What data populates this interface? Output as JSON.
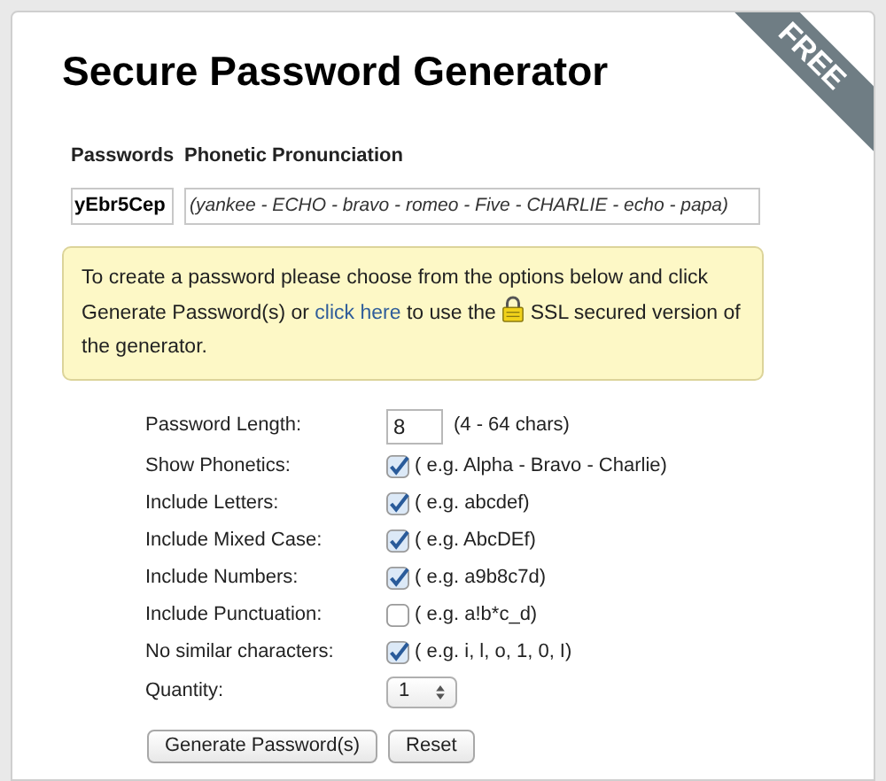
{
  "title": "Secure Password Generator",
  "ribbon": "FREE",
  "results": {
    "columns": [
      "Passwords",
      "Phonetic Pronunciation"
    ],
    "rows": [
      {
        "password": "yEbr5Cep",
        "phonetic": "(yankee - ECHO - bravo - romeo - Five - CHARLIE - echo - papa)"
      }
    ]
  },
  "info": {
    "before": "To create a password please choose from the options below and click Generate Password(s) or",
    "link": "click here",
    "middle": "to use the",
    "after": "SSL secured version of the generator."
  },
  "options": [
    {
      "kind": "number",
      "label": "Password Length:",
      "value": "8",
      "hint": "(4 - 64 chars)"
    },
    {
      "kind": "checkbox",
      "label": "Show Phonetics:",
      "checked": true,
      "hint": "( e.g. Alpha - Bravo - Charlie)"
    },
    {
      "kind": "checkbox",
      "label": "Include Letters:",
      "checked": true,
      "hint": "( e.g. abcdef)"
    },
    {
      "kind": "checkbox",
      "label": "Include Mixed Case:",
      "checked": true,
      "hint": "( e.g. AbcDEf)"
    },
    {
      "kind": "checkbox",
      "label": "Include Numbers:",
      "checked": true,
      "hint": "( e.g. a9b8c7d)"
    },
    {
      "kind": "checkbox",
      "label": "Include Punctuation:",
      "checked": false,
      "hint": "( e.g. a!b*c_d)"
    },
    {
      "kind": "checkbox",
      "label": "No similar characters:",
      "checked": true,
      "hint": "( e.g. i, l, o, 1, 0, I)"
    },
    {
      "kind": "select",
      "label": "Quantity:",
      "value": "1"
    }
  ],
  "buttons": [
    "Generate Password(s)",
    "Reset"
  ]
}
